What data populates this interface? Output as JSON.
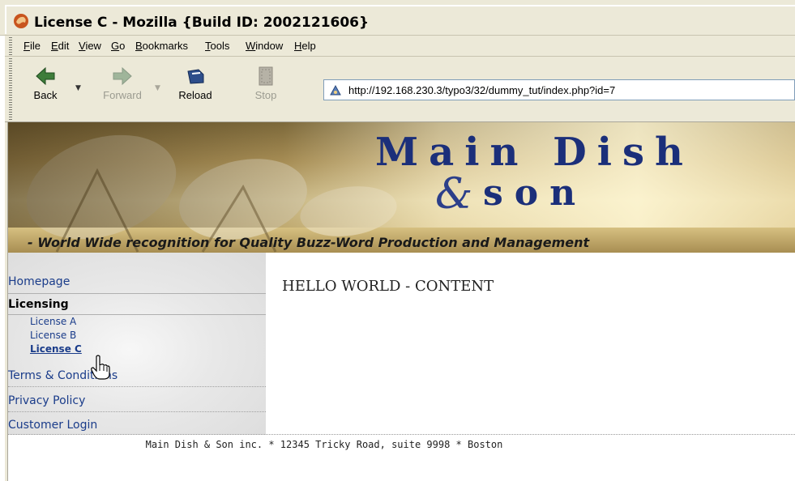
{
  "window": {
    "title": "License C - Mozilla {Build ID: 2002121606}"
  },
  "menubar": {
    "items": [
      {
        "label": "File",
        "accel": "F"
      },
      {
        "label": "Edit",
        "accel": "E"
      },
      {
        "label": "View",
        "accel": "V"
      },
      {
        "label": "Go",
        "accel": "G"
      },
      {
        "label": "Bookmarks",
        "accel": "B"
      },
      {
        "label": "Tools",
        "accel": "T"
      },
      {
        "label": "Window",
        "accel": "W"
      },
      {
        "label": "Help",
        "accel": "H"
      }
    ]
  },
  "toolbar": {
    "back_label": "Back",
    "forward_label": "Forward",
    "reload_label": "Reload",
    "stop_label": "Stop",
    "forward_enabled": false,
    "stop_enabled": false
  },
  "urlbar": {
    "value": "http://192.168.230.3/typo3/32/dummy_tut/index.php?id=7"
  },
  "banner": {
    "title_line1": "Main Dish",
    "ampersand": "&",
    "title_line2": "son",
    "tagline": "- World Wide recognition for Quality Buzz-Word Production and Management",
    "title_color": "#1b2f7a"
  },
  "sidebar": {
    "homepage": "Homepage",
    "licensing": "Licensing",
    "sub_items": [
      "License A",
      "License B",
      "License C"
    ],
    "current_sub": "License C",
    "terms": "Terms & Conditions",
    "privacy": "Privacy Policy",
    "login": "Customer Login",
    "link_color": "#1a3c8a"
  },
  "main": {
    "content": "HELLO WORLD - CONTENT"
  },
  "footer": {
    "text": "Main Dish & Son inc. * 12345 Tricky Road, suite 9998 * Boston"
  }
}
